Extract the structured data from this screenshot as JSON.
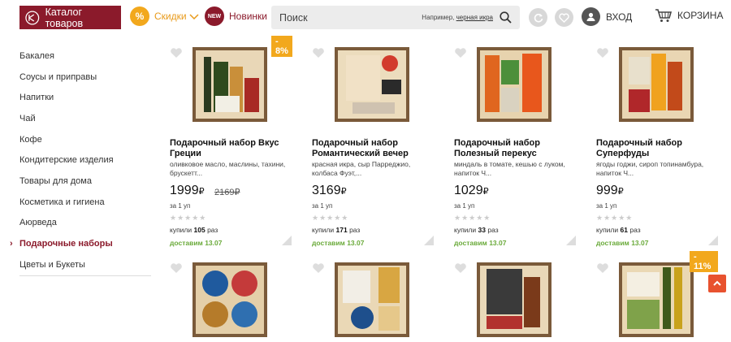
{
  "header": {
    "catalog_label": "Каталог товаров",
    "discounts_label": "Скидки",
    "discounts_icon": "%",
    "news_badge": "NEW",
    "news_label": "Новинки",
    "search_placeholder": "Поиск",
    "search_hint_prefix": "Например,",
    "search_hint_link": "черная икра",
    "login_label": "ВХОД",
    "cart_label": "КОРЗИНА"
  },
  "sidebar": {
    "items": [
      {
        "label": "Бакалея"
      },
      {
        "label": "Соусы и приправы"
      },
      {
        "label": "Напитки"
      },
      {
        "label": "Чай"
      },
      {
        "label": "Кофе"
      },
      {
        "label": "Кондитерские изделия"
      },
      {
        "label": "Товары для дома"
      },
      {
        "label": "Косметика и гигиена"
      },
      {
        "label": "Аюрведа"
      },
      {
        "label": "Подарочные наборы",
        "active": true,
        "chevron": "›"
      },
      {
        "label": "Цветы и Букеты"
      }
    ]
  },
  "products": [
    {
      "badge": "- 8%",
      "title": "Подарочный набор Вкус Греции",
      "desc": "оливковое масло, маслины, тахини, брускетт...",
      "price": "1999",
      "currency": "₽",
      "old_price": "2169₽",
      "unit": "за 1 уп",
      "bought_prefix": "купили",
      "bought_count": "105",
      "bought_suffix": "раз",
      "delivery": "доставим 13.07",
      "rating": 0
    },
    {
      "badge": "",
      "title": "Подарочный набор Романтический вечер",
      "desc": "красная икра, сыр Парреджио, колбаса Фуэт,...",
      "price": "3169",
      "currency": "₽",
      "old_price": "",
      "unit": "за 1 уп",
      "bought_prefix": "купили",
      "bought_count": "171",
      "bought_suffix": "раз",
      "delivery": "доставим 13.07",
      "rating": 0
    },
    {
      "badge": "",
      "title": "Подарочный набор Полезный перекус",
      "desc": "миндаль в томате, кешью с луком, напиток Ч...",
      "price": "1029",
      "currency": "₽",
      "old_price": "",
      "unit": "за 1 уп",
      "bought_prefix": "купили",
      "bought_count": "33",
      "bought_suffix": "раз",
      "delivery": "доставим 13.07",
      "rating": 0
    },
    {
      "badge": "",
      "title": "Подарочный набор Суперфуды",
      "desc": "ягоды годжи, сироп топинамбура, напиток Ч...",
      "price": "999",
      "currency": "₽",
      "old_price": "",
      "unit": "за 1 уп",
      "bought_prefix": "купили",
      "bought_count": "61",
      "bought_suffix": "раз",
      "delivery": "доставим 13.07",
      "rating": 0
    }
  ],
  "products_row2": [
    {
      "badge": ""
    },
    {
      "badge": ""
    },
    {
      "badge": ""
    },
    {
      "badge": "- 11%"
    }
  ],
  "colors": {
    "brand": "#8b1a2b",
    "accent": "#f2a81d",
    "delivery": "#6aaa3a",
    "scroll_top": "#e8522f"
  }
}
